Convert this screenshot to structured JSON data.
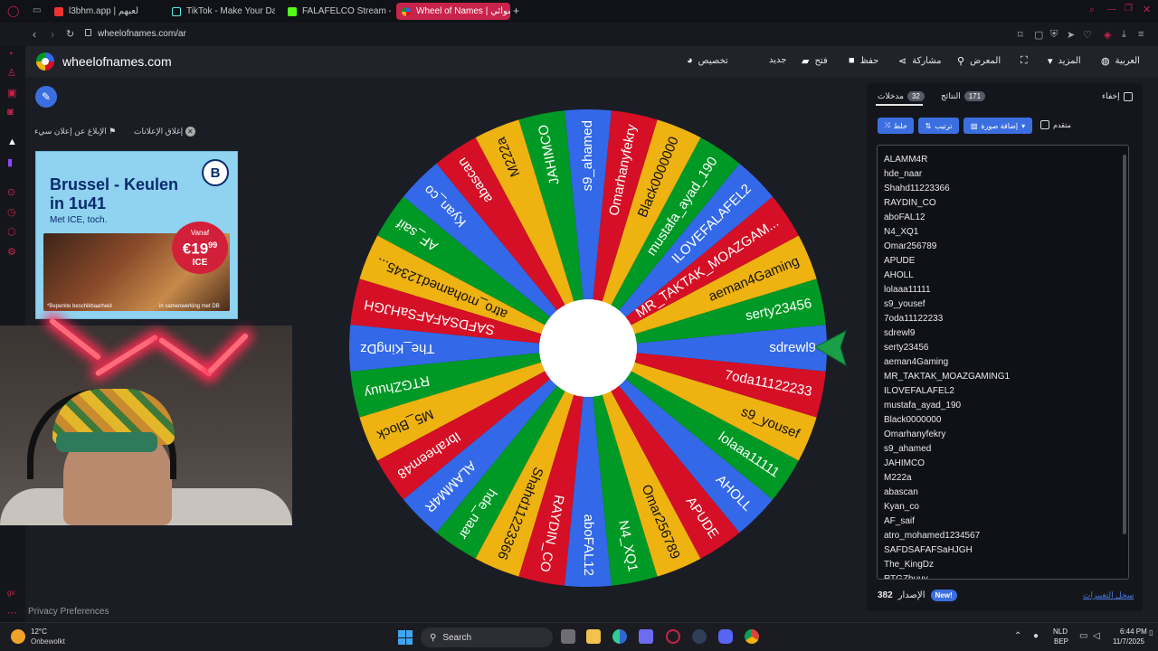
{
  "browser": {
    "tabs": [
      {
        "label": "l3bhm.app | لعبهم",
        "active": false
      },
      {
        "label": "TikTok - Make Your Day",
        "active": false
      },
      {
        "label": "FALAFELCO Stream - Wa",
        "active": false
      },
      {
        "label": "Wheel of Names | عشوائي",
        "active": true
      }
    ],
    "new_tab": "+",
    "url": "wheelofnames.com/ar"
  },
  "site": {
    "title": "wheelofnames.com",
    "menu": {
      "customize": "تخصيص",
      "new": "جديد",
      "open": "فتح",
      "save": "حفظ",
      "share": "مشاركة",
      "gallery": "المعرض",
      "more": "المزيد",
      "language": "العربية"
    }
  },
  "ads": {
    "report_label": "الإبلاغ عن إعلان سيء",
    "close_label": "إغلاق الإعلانات",
    "headline": "Brussel - Keulen in 1u41",
    "subline": "Met ICE, toch.",
    "logo": "B",
    "price_from": "Vanaf",
    "price": "€19",
    "price_cents": "99",
    "price_product": "ICE",
    "footnote_left": "*Beperkte beschikbaarheid",
    "footnote_right": "in samenwerking met DB"
  },
  "wheel": {
    "colors": [
      "#3369e8",
      "#009925",
      "#eeb211",
      "#d50f25"
    ],
    "pointer_color": "#1a9e46",
    "names": [
      "sdrewl9",
      "serty23456",
      "aeman4Gaming",
      "MR_TAKTAK_MOAZGAM...",
      "ILOVEFALAFEL2",
      "mustafa_ayad_190",
      "Black0000000",
      "Omarhanyfekry",
      "s9_ahamed",
      "JAHIMCO",
      "M222a",
      "abascan",
      "Kyan_co",
      "AF_saif",
      "atro_mohamed12345...",
      "SAFDSAFAFSaHJGH",
      "The_KingDz",
      "RTGZhuuy",
      "M5_Block",
      "Ibraheem48",
      "ALAMM4R",
      "hde_naar",
      "Shahd11223366",
      "RAYDIN_CO",
      "aboFAL12",
      "N4_XQ1",
      "Omar256789",
      "APUDE",
      "AHOLL",
      "lolaaa11111",
      "s9_yousef",
      "7oda11122233"
    ]
  },
  "panel": {
    "tab_entries": "مدخلات",
    "entries_count": "32",
    "tab_results": "النتائج",
    "results_count": "171",
    "hide_label": "إخفاء",
    "shuffle_label": "خلط",
    "sort_label": "ترتيب",
    "add_image_label": "إضافة صورة",
    "advanced_label": "متقدم",
    "entries": [
      "ALAMM4R",
      "hde_naar",
      "Shahd11223366",
      "RAYDIN_CO",
      "aboFAL12",
      "N4_XQ1",
      "Omar256789",
      "APUDE",
      "AHOLL",
      "lolaaa11111",
      "s9_yousef",
      "7oda11122233",
      "sdrewl9",
      "serty23456",
      "aeman4Gaming",
      "MR_TAKTAK_MOAZGAMING1",
      "ILOVEFALAFEL2",
      "mustafa_ayad_190",
      "Black0000000",
      "Omarhanyfekry",
      "s9_ahamed",
      "JAHIMCO",
      "M222a",
      "abascan",
      "Kyan_co",
      "AF_saif",
      "atro_mohamed1234567",
      "SAFDSAFAFSaHJGH",
      "The_KingDz",
      "RTGZhuuy"
    ],
    "version_label": "الإصدار",
    "version_number": "382",
    "new_badge": "New!",
    "changelog_label": "سجل التغييرات"
  },
  "privacy": "Privacy Preferences",
  "taskbar": {
    "temperature": "12°C",
    "weather": "Onbewolkt",
    "search_placeholder": "Search",
    "lang_line1": "NLD",
    "lang_line2": "BEP",
    "time": "6:44 PM",
    "date": "11/7/2025"
  }
}
